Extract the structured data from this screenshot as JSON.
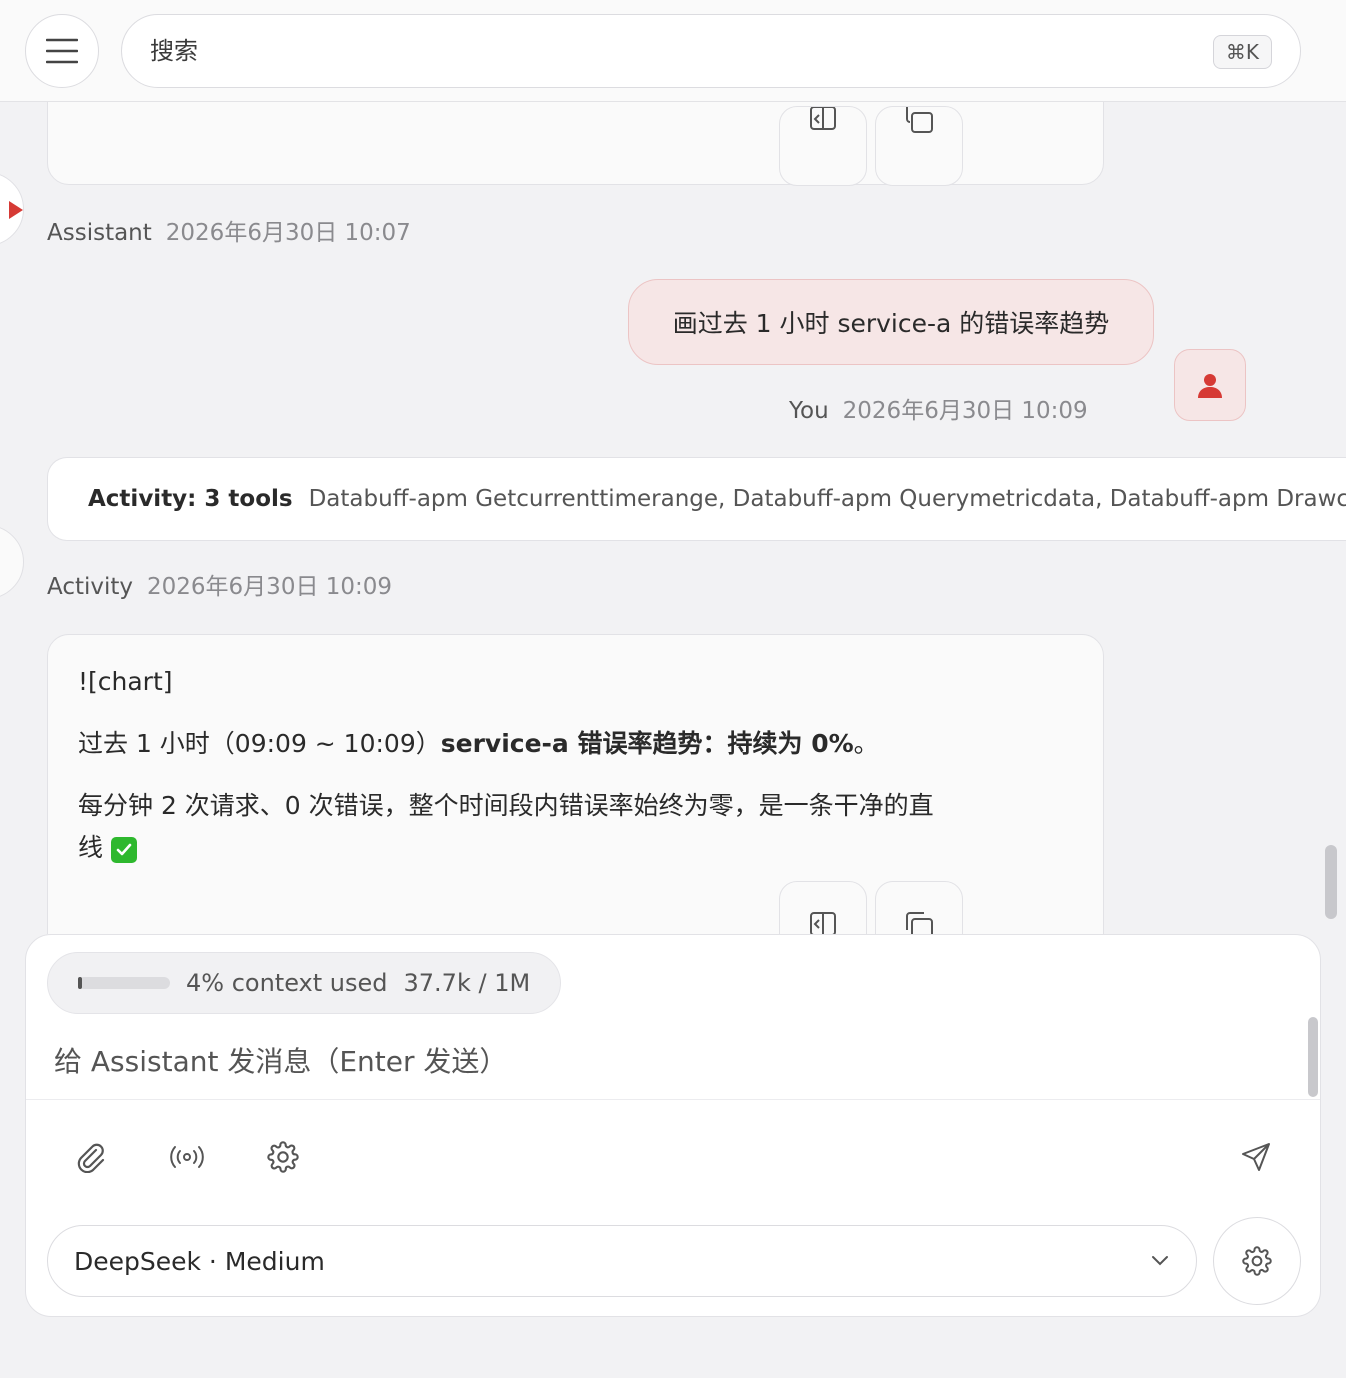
{
  "search": {
    "placeholder": "搜索",
    "shortcut": "⌘K"
  },
  "messages": {
    "assistant_prev": {
      "author": "Assistant",
      "time": "2026年6月30日 10:07"
    },
    "user": {
      "text": "画过去 1 小时 service-a 的错误率趋势",
      "author": "You",
      "time": "2026年6月30日 10:09"
    },
    "activity": {
      "title": "Activity: 3 tools",
      "tools": "Databuff-apm Getcurrenttimerange, Databuff-apm Querymetricdata, Databuff-apm Drawchart",
      "author": "Activity",
      "time": "2026年6月30日 10:09"
    },
    "assistant": {
      "image_alt": "![chart]",
      "line1_prefix": "过去 1 小时（09:09 ~ 10:09）",
      "line1_bold": "service-a 错误率趋势：持续为 0%",
      "line1_suffix": "。",
      "line2": "每分钟 2 次请求、0 次错误，整个时间段内错误率始终为零，是一条干净的直线"
    }
  },
  "composer": {
    "context_label": "4% context used",
    "context_count": "37.7k / 1M",
    "context_percent": 4,
    "placeholder": "给 Assistant 发消息（Enter 发送）",
    "model": "DeepSeek · Medium"
  },
  "colors": {
    "accent": "#d63a35",
    "user_bubble_bg": "#f6e6e6",
    "user_bubble_border": "#ecc4c4",
    "check_green": "#2eb82e"
  }
}
